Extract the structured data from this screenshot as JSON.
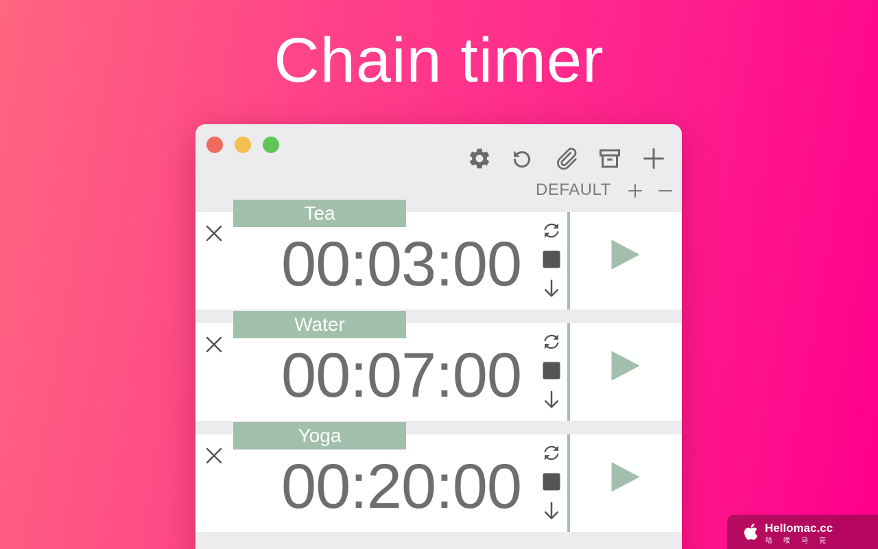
{
  "hero": {
    "title": "Chain timer"
  },
  "toolbar": {
    "icons": [
      "gear-icon",
      "reset-icon",
      "paperclip-icon",
      "archive-icon",
      "plus-icon"
    ]
  },
  "preset": {
    "name": "DEFAULT",
    "add_symbol": "+",
    "remove_symbol": "−"
  },
  "timers": [
    {
      "label": "Tea",
      "time": "00:03:00"
    },
    {
      "label": "Water",
      "time": "00:07:00"
    },
    {
      "label": "Yoga",
      "time": "00:20:00"
    }
  ],
  "colors": {
    "background_start": "#ff6680",
    "background_end": "#ff008a",
    "accent_green": "#a2bfab",
    "time_text": "#6e6e6e",
    "window_bg": "#ececee"
  },
  "watermark": {
    "name": "Hellomac.cc",
    "subtitle": "哈喽马克"
  }
}
